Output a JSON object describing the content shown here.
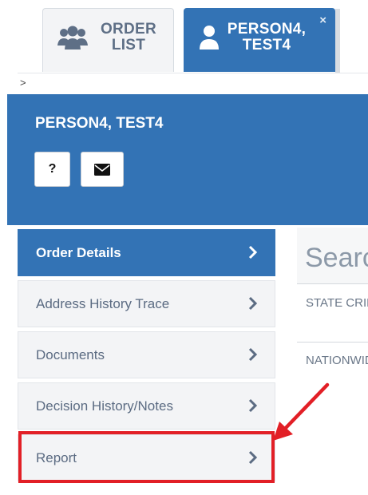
{
  "tabs": {
    "order_list": {
      "line1": "ORDER",
      "line2": "LIST",
      "icon": "users-icon"
    },
    "person": {
      "line1": "PERSON4,",
      "line2": "TEST4",
      "icon": "user-icon",
      "close": "×"
    }
  },
  "breadcrumb": {
    "arrow": ">"
  },
  "header": {
    "name": "PERSON4, TEST4",
    "help_label": "?",
    "mail_icon": "envelope-icon"
  },
  "menu": {
    "items": [
      {
        "label": "Order Details",
        "active": true
      },
      {
        "label": "Address History Trace",
        "active": false
      },
      {
        "label": "Documents",
        "active": false
      },
      {
        "label": "Decision History/Notes",
        "active": false
      },
      {
        "label": "Report",
        "active": false
      }
    ]
  },
  "content": {
    "search_title": "Search",
    "rows": [
      "STATE CRIMINAL",
      "NATIONWIDE"
    ]
  },
  "annotation": {
    "color": "#e21f26"
  },
  "colors": {
    "primary": "#3373b5",
    "tab_bg": "#f3f4f6",
    "text_muted": "#5b6b82"
  }
}
